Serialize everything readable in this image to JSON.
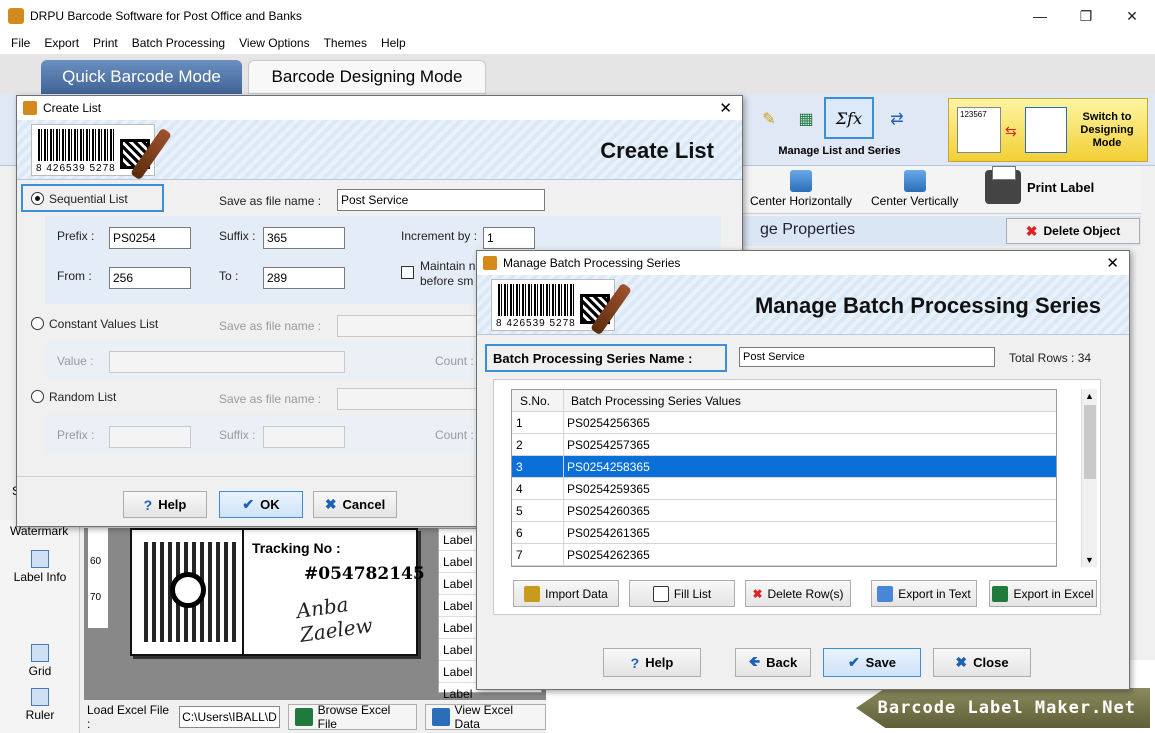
{
  "app": {
    "title": "DRPU Barcode Software for Post Office and Banks",
    "min_btn": "—",
    "max_btn": "❐",
    "close_btn": "✕"
  },
  "menu": [
    "File",
    "Export",
    "Print",
    "Batch Processing",
    "View Options",
    "Themes",
    "Help"
  ],
  "modes": {
    "quick": "Quick Barcode Mode",
    "designing": "Barcode Designing Mode"
  },
  "ribbon": {
    "manage_label": "Manage List and Series",
    "sigma_symbol": "Σfx",
    "switch_text": "Switch to Designing Mode",
    "switch_number": "123567"
  },
  "toolbar2": {
    "center_h": "Center Horizontally",
    "center_v": "Center Vertically",
    "print_label": "Print Label"
  },
  "properties": {
    "title": "ge Properties",
    "delete_object": "Delete Object"
  },
  "left_panel": {
    "watermark": "Watermark",
    "label_info": "Label Info",
    "grid": "Grid",
    "ruler": "Ruler",
    "s_marker": "S"
  },
  "ruler": {
    "tick_60": "60",
    "tick_70": "70"
  },
  "label_preview": {
    "tracking_label": "Tracking No :",
    "tracking_number": "#054782145",
    "signature": "Anba Zaelew"
  },
  "label_list": [
    "Label",
    "Label",
    "Label",
    "Label",
    "Label",
    "Label",
    "Label",
    "Label"
  ],
  "excel_bar": {
    "label": "Load Excel File :",
    "path": "C:\\Users\\IBALL\\D",
    "browse": "Browse Excel File",
    "view": "View Excel Data"
  },
  "brand": "Barcode Label Maker.Net",
  "create_list": {
    "title": "Create List",
    "header": "Create List",
    "barcode_digits": "8 426539 5278",
    "sequential": {
      "label": "Sequential List",
      "save_as_label": "Save as file name :",
      "save_as_value": "Post Service",
      "prefix_label": "Prefix :",
      "prefix_value": "PS0254",
      "suffix_label": "Suffix :",
      "suffix_value": "365",
      "increment_label": "Increment by :",
      "increment_value": "1",
      "from_label": "From :",
      "from_value": "256",
      "to_label": "To :",
      "to_value": "289",
      "maintain_label": "Maintain n",
      "maintain_label2": "before sm"
    },
    "constant": {
      "label": "Constant Values List",
      "save_as_label": "Save as file name :",
      "value_label": "Value :",
      "count_label": "Count :"
    },
    "random": {
      "label": "Random List",
      "save_as_label": "Save as file name :",
      "prefix_label": "Prefix :",
      "suffix_label": "Suffix :",
      "count_label": "Count :"
    },
    "buttons": {
      "help": "Help",
      "ok": "OK",
      "cancel": "Cancel"
    }
  },
  "batch": {
    "title": "Manage Batch Processing Series",
    "header": "Manage Batch Processing Series",
    "barcode_digits": "8 426539 5278",
    "series_name_label": "Batch Processing Series Name :",
    "series_name_value": "Post Service",
    "total_rows": "Total Rows : 34",
    "columns": [
      "S.No.",
      "Batch Processing Series Values"
    ],
    "rows": [
      {
        "sno": "1",
        "value": "PS0254256365"
      },
      {
        "sno": "2",
        "value": "PS0254257365"
      },
      {
        "sno": "3",
        "value": "PS0254258365"
      },
      {
        "sno": "4",
        "value": "PS0254259365"
      },
      {
        "sno": "5",
        "value": "PS0254260365"
      },
      {
        "sno": "6",
        "value": "PS0254261365"
      },
      {
        "sno": "7",
        "value": "PS0254262365"
      }
    ],
    "selected_row": 2,
    "actions": {
      "import": "Import Data",
      "fill": "Fill List",
      "delete": "Delete Row(s)",
      "export_text": "Export in Text",
      "export_excel": "Export in Excel"
    },
    "buttons": {
      "help": "Help",
      "back": "Back",
      "save": "Save",
      "close": "Close"
    }
  }
}
